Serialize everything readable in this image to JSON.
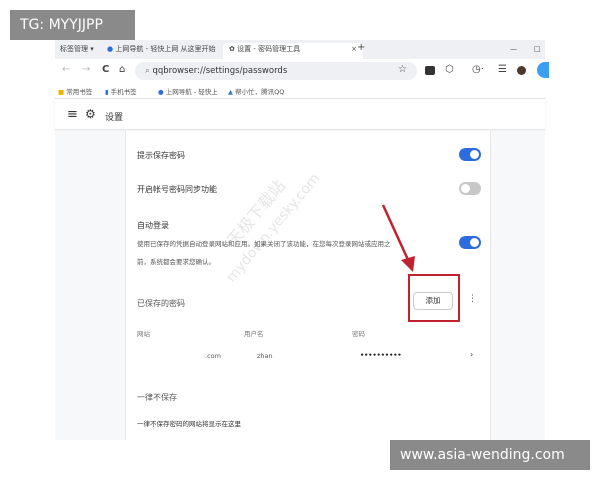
{
  "tabs": {
    "bookmark_manager": "标签管理 ▾",
    "tab1": "上网导航 - 轻快上网 从这里开始",
    "tab2": "设置 - 密码管理工具",
    "close": "×",
    "new": "+",
    "minimize": "—",
    "maximize": "□"
  },
  "toolbar": {
    "url": "qqbrowser://settings/passwords",
    "back": "←",
    "forward": "→",
    "reload": "C",
    "home": "⌂",
    "search": "⌕",
    "star": "☆",
    "history": "◷·",
    "menu": "☰"
  },
  "bookmarks": [
    "常用书签",
    "手机书签",
    "上网导航 - 轻快上",
    "帮小忙，腾讯QQ"
  ],
  "header": {
    "title": "设置",
    "menu": "≡",
    "gear": "⚙"
  },
  "settings": {
    "offer_save": {
      "label": "提示保存密码",
      "on": true
    },
    "sync": {
      "label": "开启帐号密码同步功能",
      "on": false
    },
    "auto_login": {
      "label": "自动登录",
      "desc1": "使用已保存的凭据自动登录网站和应用。如果关闭了该功能，在您每次登录网站或应用之",
      "desc2": "前，系统都会要求您确认。",
      "on": true
    }
  },
  "saved": {
    "title": "已保存的密码",
    "add": "添加",
    "more": "⋮",
    "columns": [
      "网站",
      "用户名",
      "密码"
    ],
    "row": {
      "site": ".com",
      "user": "zhan",
      "password": "••••••••••",
      "chevron": "›"
    }
  },
  "never": {
    "title": "一律不保存",
    "empty": "一律不保存密码的网站将显示在这里"
  },
  "watermarks": {
    "tg": "TG: MYYJJPP",
    "site": "www.asia-wending.com",
    "diag1": "天极下载站",
    "diag2": "mydown.yesky.com"
  },
  "colors": {
    "accent": "#2d6be0",
    "annotation": "#c0232f"
  }
}
